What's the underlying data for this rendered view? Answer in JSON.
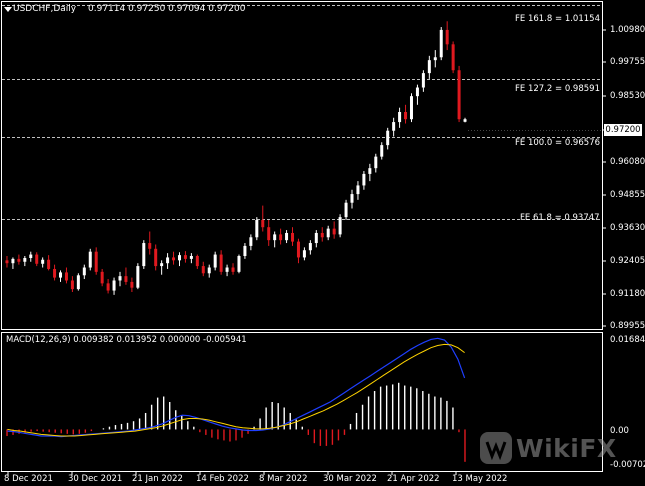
{
  "header": {
    "symbol": "USDCHF,Daily",
    "ohlc": "0.97114 0.97250 0.97094 0.97200"
  },
  "macd": {
    "label": "MACD(12,26,9) 0.009382 0.013952 0.000000 -0.005941",
    "axis_ticks": [
      "0.016843",
      "0.00",
      "-0.007025"
    ]
  },
  "price_axis": {
    "ticks": [
      "1.00980",
      "0.99755",
      "0.98530",
      "0.97200",
      "0.96080",
      "0.94855",
      "0.93630",
      "0.92405",
      "0.91180",
      "0.89955"
    ],
    "current_price": "0.97200"
  },
  "fib_levels": [
    {
      "label": "FE 161.8 = 1.01154",
      "value": 1.01154
    },
    {
      "label": "FE 127.2 = 0.98591",
      "value": 0.98591
    },
    {
      "label": "FE 100.0 = 0.96576",
      "value": 0.96576
    },
    {
      "label": "FE 61.8 = 0.93747",
      "value": 0.93747
    }
  ],
  "date_axis": [
    "8 Dec 2021",
    "30 Dec 2021",
    "21 Jan 2022",
    "14 Feb 2022",
    "8 Mar 2022",
    "30 Mar 2022",
    "21 Apr 2022",
    "13 May 2022"
  ],
  "watermark": {
    "text": "WikiFX"
  },
  "colors": {
    "bull": "#ffffff",
    "bear": "#e0191f",
    "macd_line": "#1f3fff",
    "signal_line": "#ffd400",
    "background": "#000000",
    "grid": "#ffffff"
  },
  "chart_data": {
    "type": "candlestick",
    "timeframe": "Daily",
    "series": [
      {
        "name": "USDCHF",
        "values": [
          [
            0.923,
            0.9245,
            0.9205,
            0.922
          ],
          [
            0.922,
            0.924,
            0.92,
            0.9235
          ],
          [
            0.9235,
            0.925,
            0.9215,
            0.9225
          ],
          [
            0.9225,
            0.9245,
            0.921,
            0.9238
          ],
          [
            0.9238,
            0.926,
            0.9225,
            0.925
          ],
          [
            0.925,
            0.9258,
            0.921,
            0.9218
          ],
          [
            0.9218,
            0.924,
            0.9205,
            0.9232
          ],
          [
            0.9232,
            0.9248,
            0.9195,
            0.92
          ],
          [
            0.92,
            0.9215,
            0.916,
            0.917
          ],
          [
            0.917,
            0.9195,
            0.9155,
            0.9188
          ],
          [
            0.9188,
            0.9205,
            0.915,
            0.916
          ],
          [
            0.916,
            0.9175,
            0.912,
            0.913
          ],
          [
            0.913,
            0.9185,
            0.9125,
            0.9178
          ],
          [
            0.9178,
            0.9215,
            0.9165,
            0.9205
          ],
          [
            0.9205,
            0.927,
            0.9195,
            0.926
          ],
          [
            0.926,
            0.9275,
            0.918,
            0.919
          ],
          [
            0.919,
            0.92,
            0.914,
            0.915
          ],
          [
            0.915,
            0.9165,
            0.9115,
            0.9125
          ],
          [
            0.9125,
            0.917,
            0.911,
            0.916
          ],
          [
            0.916,
            0.919,
            0.914,
            0.9175
          ],
          [
            0.9175,
            0.9205,
            0.9145,
            0.9155
          ],
          [
            0.9155,
            0.917,
            0.912,
            0.9135
          ],
          [
            0.9135,
            0.922,
            0.913,
            0.921
          ],
          [
            0.921,
            0.93,
            0.92,
            0.929
          ],
          [
            0.929,
            0.933,
            0.925,
            0.927
          ],
          [
            0.927,
            0.9285,
            0.9195,
            0.921
          ],
          [
            0.921,
            0.923,
            0.918,
            0.922
          ],
          [
            0.922,
            0.9255,
            0.92,
            0.924
          ],
          [
            0.924,
            0.926,
            0.9215,
            0.923
          ],
          [
            0.923,
            0.9258,
            0.921,
            0.9248
          ],
          [
            0.9248,
            0.9262,
            0.9222,
            0.9235
          ],
          [
            0.9235,
            0.9255,
            0.922,
            0.9245
          ],
          [
            0.9245,
            0.925,
            0.92,
            0.921
          ],
          [
            0.921,
            0.9225,
            0.9175,
            0.9185
          ],
          [
            0.9185,
            0.9215,
            0.917,
            0.9205
          ],
          [
            0.9205,
            0.926,
            0.9195,
            0.925
          ],
          [
            0.925,
            0.9265,
            0.918,
            0.919
          ],
          [
            0.919,
            0.9215,
            0.9175,
            0.9205
          ],
          [
            0.9205,
            0.922,
            0.918,
            0.919
          ],
          [
            0.919,
            0.925,
            0.9185,
            0.9245
          ],
          [
            0.9245,
            0.929,
            0.9235,
            0.928
          ],
          [
            0.928,
            0.932,
            0.9265,
            0.931
          ],
          [
            0.931,
            0.938,
            0.93,
            0.937
          ],
          [
            0.937,
            0.942,
            0.933,
            0.9345
          ],
          [
            0.9345,
            0.937,
            0.928,
            0.93
          ],
          [
            0.93,
            0.933,
            0.9275,
            0.932
          ],
          [
            0.932,
            0.934,
            0.9285,
            0.93
          ],
          [
            0.93,
            0.9335,
            0.929,
            0.9325
          ],
          [
            0.9325,
            0.9345,
            0.928,
            0.9295
          ],
          [
            0.9295,
            0.9305,
            0.922,
            0.924
          ],
          [
            0.924,
            0.9275,
            0.923,
            0.9265
          ],
          [
            0.9265,
            0.93,
            0.925,
            0.929
          ],
          [
            0.929,
            0.9335,
            0.9275,
            0.9325
          ],
          [
            0.9325,
            0.9345,
            0.9295,
            0.931
          ],
          [
            0.931,
            0.935,
            0.93,
            0.934
          ],
          [
            0.934,
            0.9365,
            0.9305,
            0.932
          ],
          [
            0.932,
            0.939,
            0.931,
            0.938
          ],
          [
            0.938,
            0.944,
            0.937,
            0.943
          ],
          [
            0.943,
            0.9475,
            0.941,
            0.946
          ],
          [
            0.946,
            0.9505,
            0.944,
            0.949
          ],
          [
            0.949,
            0.954,
            0.9475,
            0.953
          ],
          [
            0.953,
            0.9565,
            0.9505,
            0.955
          ],
          [
            0.955,
            0.96,
            0.9535,
            0.959
          ],
          [
            0.959,
            0.964,
            0.958,
            0.963
          ],
          [
            0.963,
            0.969,
            0.9615,
            0.968
          ],
          [
            0.968,
            0.9725,
            0.966,
            0.971
          ],
          [
            0.971,
            0.976,
            0.969,
            0.9745
          ],
          [
            0.9745,
            0.977,
            0.9705,
            0.972
          ],
          [
            0.972,
            0.981,
            0.971,
            0.98
          ],
          [
            0.98,
            0.984,
            0.977,
            0.983
          ],
          [
            0.983,
            0.989,
            0.9815,
            0.988
          ],
          [
            0.988,
            0.994,
            0.986,
            0.9925
          ],
          [
            0.9925,
            0.996,
            0.99,
            0.9935
          ],
          [
            0.9935,
            1.004,
            0.9925,
            1.003
          ],
          [
            1.003,
            1.006,
            0.996,
            0.998
          ],
          [
            0.998,
            0.999,
            0.988,
            0.989
          ],
          [
            0.989,
            0.9905,
            0.971,
            0.972
          ],
          [
            0.9711,
            0.9725,
            0.9709,
            0.972
          ]
        ]
      }
    ],
    "ylim": [
      0.8995,
      1.012
    ],
    "x_tick_labels": [
      "8 Dec 2021",
      "30 Dec 2021",
      "21 Jan 2022",
      "14 Feb 2022",
      "8 Mar 2022",
      "30 Mar 2022",
      "21 Apr 2022",
      "13 May 2022"
    ],
    "macd_series": {
      "histogram": [
        -0.0012,
        -0.001,
        -0.0008,
        -0.0006,
        -0.0004,
        -0.0003,
        -0.0004,
        -0.0005,
        -0.0006,
        -0.0007,
        -0.0008,
        -0.0009,
        -0.0008,
        -0.0006,
        -0.0003,
        0.0,
        0.0002,
        0.0005,
        0.0008,
        0.001,
        0.0012,
        0.0015,
        0.002,
        0.003,
        0.0045,
        0.0058,
        0.006,
        0.005,
        0.0035,
        0.0025,
        0.0015,
        0.0005,
        -0.0005,
        -0.001,
        -0.0015,
        -0.0018,
        -0.002,
        -0.0022,
        -0.002,
        -0.0015,
        -0.0008,
        0.0005,
        0.002,
        0.004,
        0.005,
        0.0048,
        0.004,
        0.003,
        0.0018,
        0.0005,
        -0.001,
        -0.0025,
        -0.003,
        -0.003,
        -0.0028,
        -0.002,
        -0.001,
        0.001,
        0.003,
        0.0045,
        0.006,
        0.007,
        0.0078,
        0.008,
        0.0082,
        0.0085,
        0.008,
        0.0078,
        0.0075,
        0.007,
        0.0065,
        0.006,
        0.0058,
        0.0052,
        0.004,
        -0.0005,
        -0.0059
      ],
      "macd": [
        -0.0003,
        -0.0004,
        -0.0006,
        -0.0008,
        -0.001,
        -0.0012,
        -0.0012,
        -0.0012,
        -0.0013,
        -0.0012,
        -0.0011,
        -0.001,
        -0.0009,
        -0.0008,
        -0.0007,
        -0.0006,
        -0.0005,
        -0.0004,
        -0.0003,
        -0.0001,
        0.0001,
        0.0003,
        0.0006,
        0.001,
        0.0016,
        0.0022,
        0.0026,
        0.0025,
        0.0022,
        0.0018,
        0.0014,
        0.001,
        0.0006,
        0.0003,
        0.0001,
        -0.0001,
        -0.0002,
        -0.0002,
        -0.0001,
        0.0001,
        0.0004,
        0.0008,
        0.0014,
        0.002,
        0.0026,
        0.0032,
        0.0038,
        0.0044,
        0.005,
        0.0058,
        0.0066,
        0.0074,
        0.0082,
        0.009,
        0.0098,
        0.0106,
        0.0114,
        0.0122,
        0.013,
        0.0138,
        0.0146,
        0.0153,
        0.0159,
        0.0164,
        0.0166,
        0.0163,
        0.015,
        0.0128,
        0.0094
      ],
      "signal": [
        0.0,
        -0.0002,
        -0.0003,
        -0.0005,
        -0.0007,
        -0.0009,
        -0.001,
        -0.0011,
        -0.0012,
        -0.0012,
        -0.0012,
        -0.0011,
        -0.001,
        -0.0009,
        -0.0008,
        -0.0007,
        -0.0006,
        -0.0005,
        -0.0004,
        -0.0003,
        -0.0001,
        0.0001,
        0.0003,
        0.0006,
        0.001,
        0.0014,
        0.0018,
        0.002,
        0.002,
        0.0019,
        0.0017,
        0.0014,
        0.0011,
        0.0008,
        0.0005,
        0.0003,
        0.0002,
        0.0001,
        0.0001,
        0.0002,
        0.0004,
        0.0007,
        0.001,
        0.0014,
        0.0019,
        0.0024,
        0.0029,
        0.0034,
        0.004,
        0.0046,
        0.0053,
        0.006,
        0.0067,
        0.0075,
        0.0083,
        0.0091,
        0.0099,
        0.0107,
        0.0115,
        0.0123,
        0.013,
        0.0137,
        0.0143,
        0.0149,
        0.0153,
        0.0155,
        0.0154,
        0.0149,
        0.014
      ],
      "range": [
        -0.007025,
        0.016843
      ]
    }
  }
}
